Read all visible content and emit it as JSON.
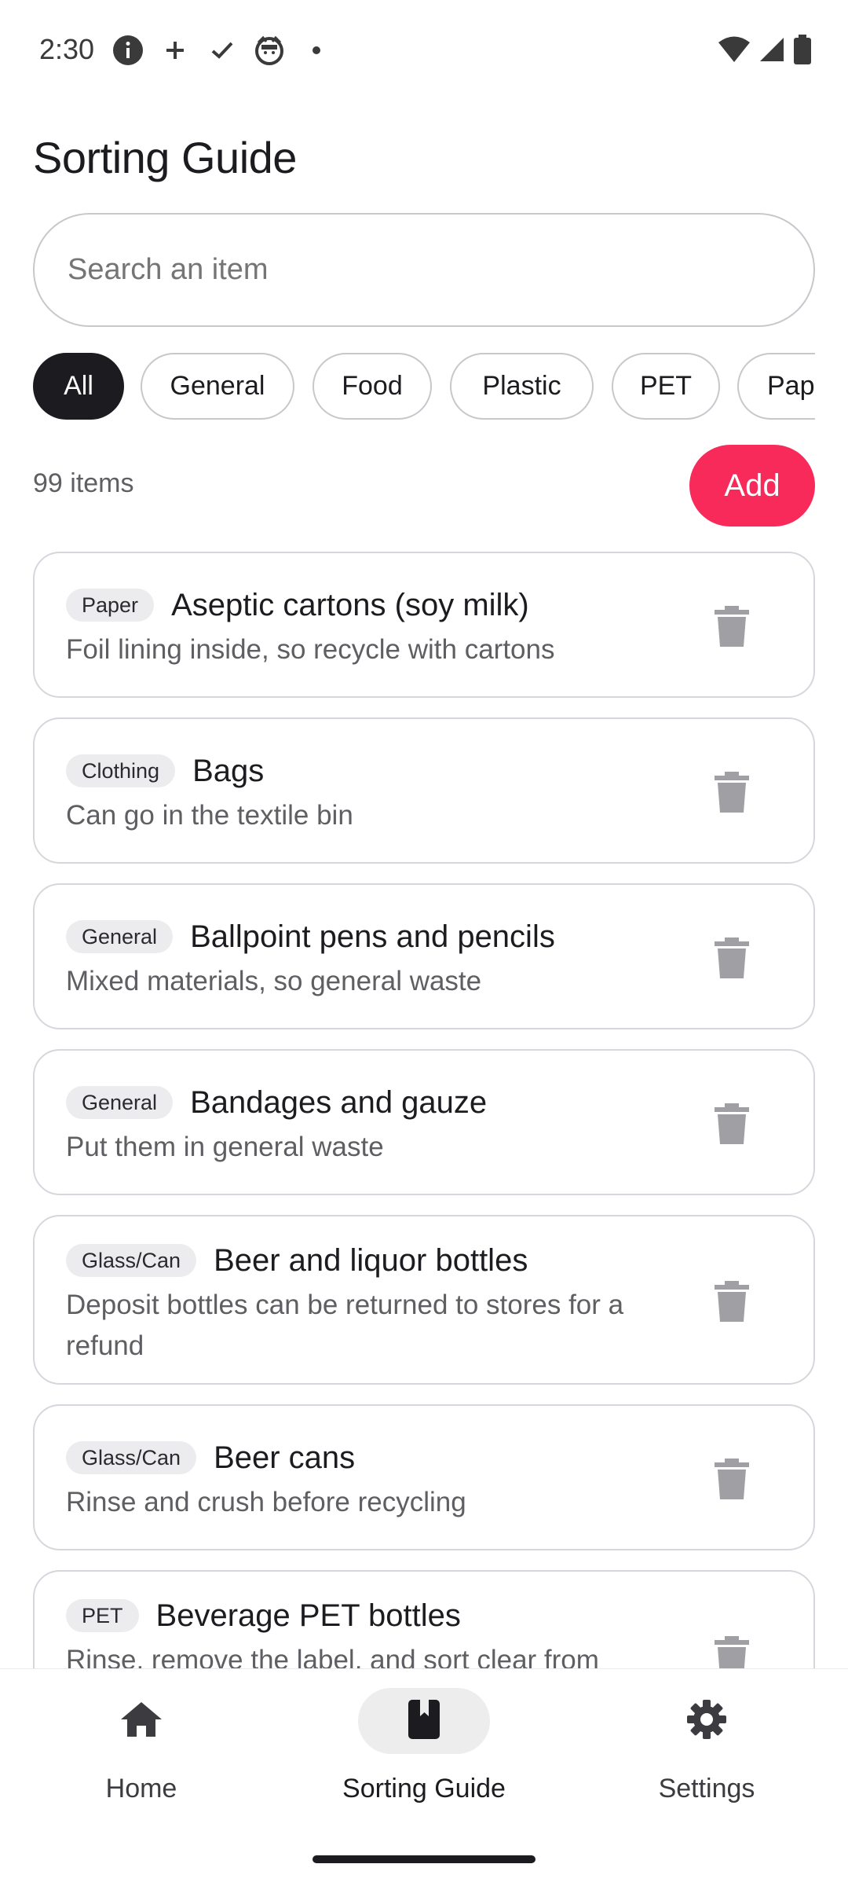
{
  "status_bar": {
    "time": "2:30",
    "left_icons": [
      "info-icon",
      "plus-icon",
      "check-icon",
      "cat-face-icon",
      "dot-icon"
    ],
    "right_icons": [
      "wifi-icon",
      "cellular-signal-icon",
      "battery-icon"
    ]
  },
  "page": {
    "title": "Sorting Guide"
  },
  "search": {
    "placeholder": "Search an item",
    "value": ""
  },
  "filter_chips": [
    {
      "label": "All",
      "selected": true
    },
    {
      "label": "General",
      "selected": false
    },
    {
      "label": "Food",
      "selected": false
    },
    {
      "label": "Plastic",
      "selected": false
    },
    {
      "label": "PET",
      "selected": false
    },
    {
      "label": "Pap",
      "selected": false
    }
  ],
  "list_header": {
    "count_label": "99 items",
    "add_label": "Add"
  },
  "items": [
    {
      "category": "Paper",
      "name": "Aseptic cartons (soy milk)",
      "desc_lines": [
        "Foil lining inside, so recycle with cartons"
      ]
    },
    {
      "category": "Clothing",
      "name": "Bags",
      "desc_lines": [
        "Can go in the textile bin"
      ]
    },
    {
      "category": "General",
      "name": "Ballpoint pens and pencils",
      "desc_lines": [
        "Mixed materials, so general waste"
      ]
    },
    {
      "category": "General",
      "name": "Bandages and gauze",
      "desc_lines": [
        "Put them in general waste"
      ]
    },
    {
      "category": "Glass/Can",
      "name": "Beer and liquor bottles",
      "desc_lines": [
        "Deposit bottles can be returned to stores for a",
        "refund"
      ]
    },
    {
      "category": "Glass/Can",
      "name": "Beer cans",
      "desc_lines": [
        "Rinse and crush before recycling"
      ]
    },
    {
      "category": "PET",
      "name": "Beverage PET bottles",
      "desc_lines": [
        "Rinse, remove the label, and sort clear from"
      ]
    }
  ],
  "bottom_nav": [
    {
      "label": "Home",
      "icon": "home-icon",
      "active": false
    },
    {
      "label": "Sorting Guide",
      "icon": "book-icon",
      "active": true
    },
    {
      "label": "Settings",
      "icon": "gear-icon",
      "active": false
    }
  ],
  "colors": {
    "accent": "#f72a5a",
    "selected_chip": "#1c1b1f",
    "badge_bg": "#ecebee",
    "muted_text": "#5f5f63"
  }
}
